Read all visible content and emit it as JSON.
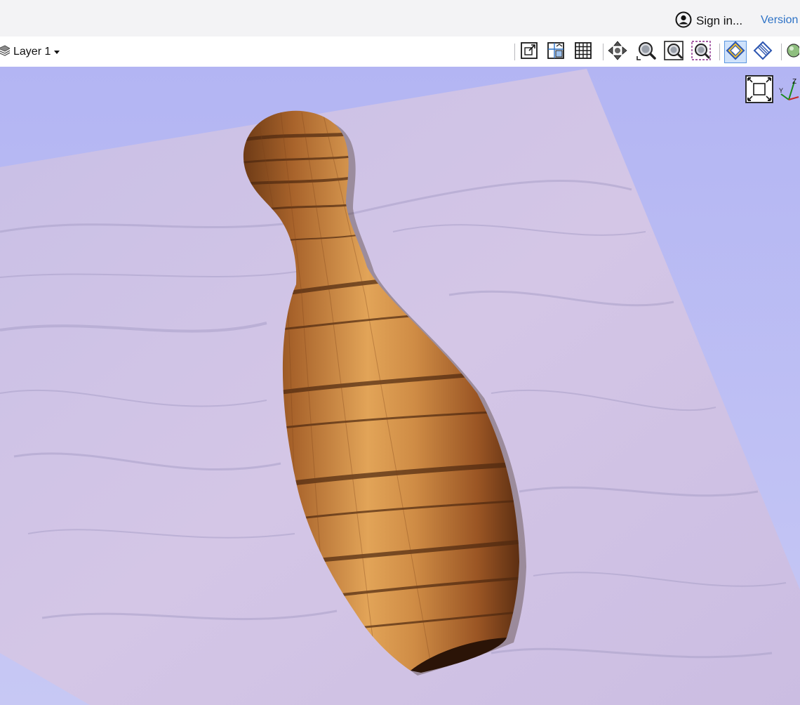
{
  "header": {
    "signin_label": "Sign in...",
    "version_label": "Version"
  },
  "toolbar": {
    "layer_label": "Layer 1",
    "active_tool": "shaded-view-icon",
    "view_tools": [
      "fit-to-view-icon",
      "plan-view-icon",
      "grid-icon",
      "pan-icon",
      "zoom-icon",
      "zoom-selected-icon",
      "zoom-box-icon",
      "shaded-view-icon",
      "wireframe-view-icon",
      "material-icon"
    ]
  },
  "viewport": {
    "axis_labels": {
      "z": "Z",
      "y": "Y"
    },
    "background_color": "#b9bbf5",
    "model_color": "#c07a3c",
    "slab_color": "#cfc2e6"
  }
}
